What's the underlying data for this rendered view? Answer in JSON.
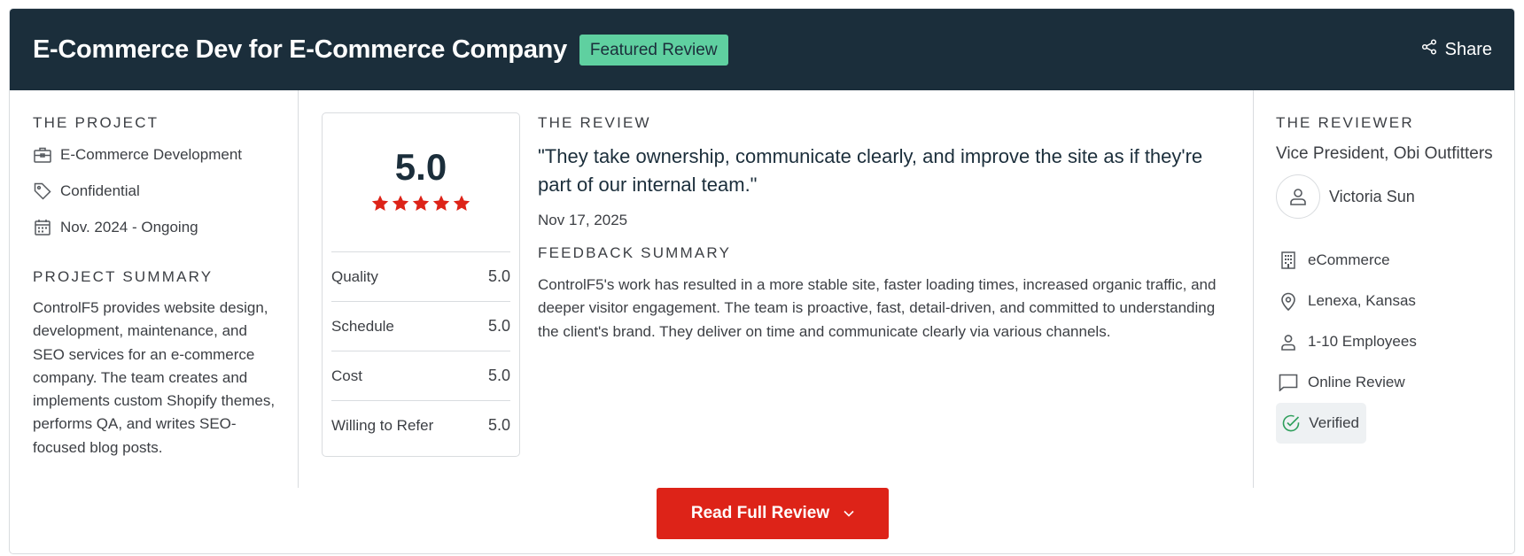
{
  "header": {
    "title": "E-Commerce Dev for E-Commerce Company",
    "badge": "Featured Review",
    "share_label": "Share"
  },
  "project": {
    "heading": "THE PROJECT",
    "service": "E-Commerce Development",
    "budget": "Confidential",
    "dates": "Nov. 2024 - Ongoing",
    "summary_heading": "PROJECT SUMMARY",
    "summary": "ControlF5 provides website design, development, maintenance, and SEO services for an e-commerce company. The team creates and implements custom Shopify themes, performs QA, and writes SEO-focused blog posts."
  },
  "ratings": {
    "overall": "5.0",
    "stars": 5,
    "rows": [
      {
        "label": "Quality",
        "value": "5.0"
      },
      {
        "label": "Schedule",
        "value": "5.0"
      },
      {
        "label": "Cost",
        "value": "5.0"
      },
      {
        "label": "Willing to Refer",
        "value": "5.0"
      }
    ]
  },
  "review": {
    "heading": "THE REVIEW",
    "quote": "\"They take ownership, communicate clearly, and improve the site as if they're part of our internal team.\"",
    "date": "Nov 17, 2025",
    "feedback_heading": "FEEDBACK SUMMARY",
    "feedback": "ControlF5's work has resulted in a more stable site, faster loading times, increased organic traffic, and deeper visitor engagement. The team is proactive, fast, detail-driven, and committed to understanding the client's brand. They deliver on time and communicate clearly via various channels."
  },
  "reviewer": {
    "heading": "THE REVIEWER",
    "title": "Vice President, Obi Outfitters",
    "name": "Victoria Sun",
    "industry": "eCommerce",
    "location": "Lenexa, Kansas",
    "size": "1-10 Employees",
    "review_type": "Online Review",
    "verified": "Verified"
  },
  "cta": {
    "read_full_review": "Read Full Review"
  },
  "colors": {
    "header_bg": "#1b2e3b",
    "badge_bg": "#5fd0a0",
    "star": "#dd2318",
    "cta_bg": "#dd2318",
    "verified_icon": "#2e9e5b"
  }
}
